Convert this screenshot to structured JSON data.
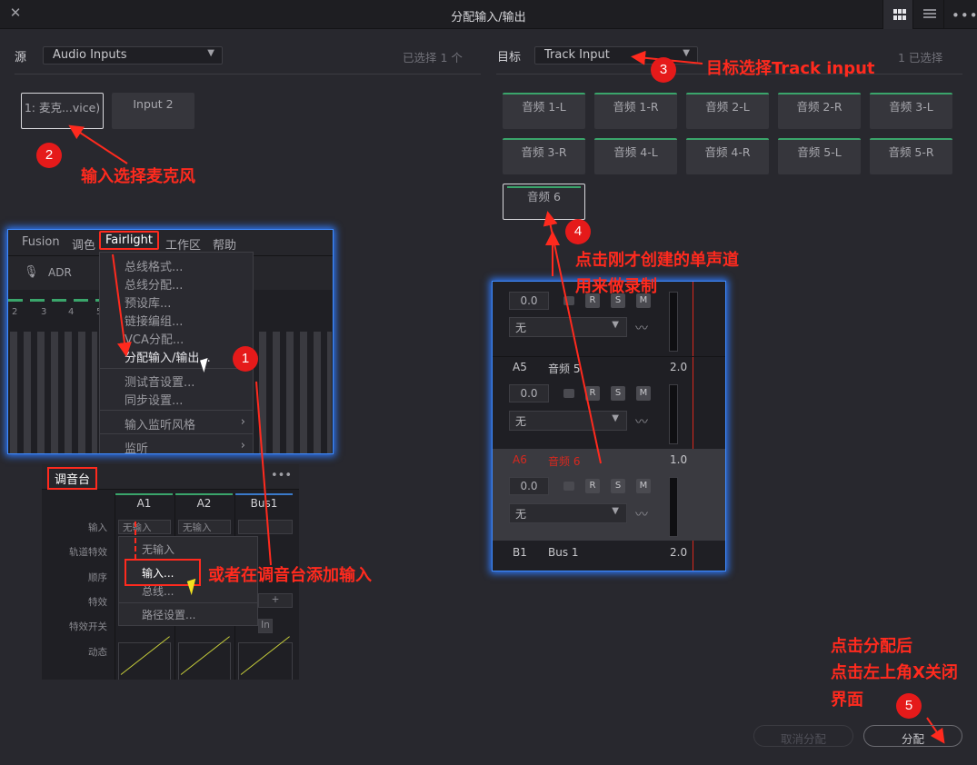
{
  "titlebar": {
    "title": "分配输入/输出",
    "close": "✕"
  },
  "source": {
    "label": "源",
    "dropdown": "Audio Inputs",
    "selected": "已选择 1 个",
    "buttons": [
      "1: 麦克...vice)",
      "Input 2"
    ]
  },
  "target": {
    "label": "目标",
    "dropdown": "Track Input",
    "selected": "1 已选择",
    "buttons": [
      "音频 1-L",
      "音频 1-R",
      "音频 2-L",
      "音频 2-R",
      "音频 3-L",
      "音频 3-R",
      "音频 4-L",
      "音频 4-R",
      "音频 5-L",
      "音频 5-R",
      "音频 6"
    ]
  },
  "menu_inset": {
    "menubar": [
      "Fusion",
      "调色",
      "Fairlight",
      "工作区",
      "帮助"
    ],
    "adr": "ADR",
    "track_nums": [
      "2",
      "3",
      "4",
      "5"
    ],
    "items": [
      "总线格式...",
      "总线分配...",
      "预设库...",
      "链接编组...",
      "VCA分配...",
      "分配输入/输出...",
      "测试音设置...",
      "同步设置...",
      "输入监听风格",
      "监听"
    ]
  },
  "mixer": {
    "title": "调音台",
    "more": "•••",
    "columns": [
      "A1",
      "A2",
      "Bus1"
    ],
    "row_labels": [
      "输入",
      "轨道特效",
      "顺序",
      "特效",
      "特效开关",
      "动态"
    ],
    "input_values": [
      "无输入",
      "无输入"
    ],
    "plus": "+",
    "in_btn": "In",
    "context_menu": [
      "无输入",
      "输入...",
      "总线...",
      "路径设置..."
    ]
  },
  "tracks": {
    "rows": [
      {
        "id": "",
        "name": "",
        "value": "0.0",
        "dropdown": "无",
        "gain": ""
      },
      {
        "id": "A5",
        "name": "音频 5",
        "value": "0.0",
        "dropdown": "无",
        "gain": "2.0"
      },
      {
        "id": "A6",
        "name": "音频 6",
        "value": "0.0",
        "dropdown": "无",
        "gain": "1.0"
      },
      {
        "id": "B1",
        "name": "Bus 1",
        "value": "",
        "dropdown": "",
        "gain": "2.0"
      }
    ],
    "btns": [
      "R",
      "S",
      "M"
    ]
  },
  "annotations": {
    "step1": "1",
    "step2": "2",
    "step3": "3",
    "step4": "4",
    "step5": "5",
    "note2": "输入选择麦克风",
    "note3": "目标选择Track input",
    "note4a": "点击刚才创建的单声道",
    "note4b": "用来做录制",
    "note_mixer": "或者在调音台添加输入",
    "note5a": "点击分配后",
    "note5b": "点击左上角X关闭",
    "note5c": "界面"
  },
  "footer": {
    "cancel": "取消分配",
    "assign": "分配"
  },
  "colors": {
    "accent_green": "#3aa56b",
    "annotation_red": "#ff2a1e",
    "inset_glow": "#2f7bff"
  }
}
